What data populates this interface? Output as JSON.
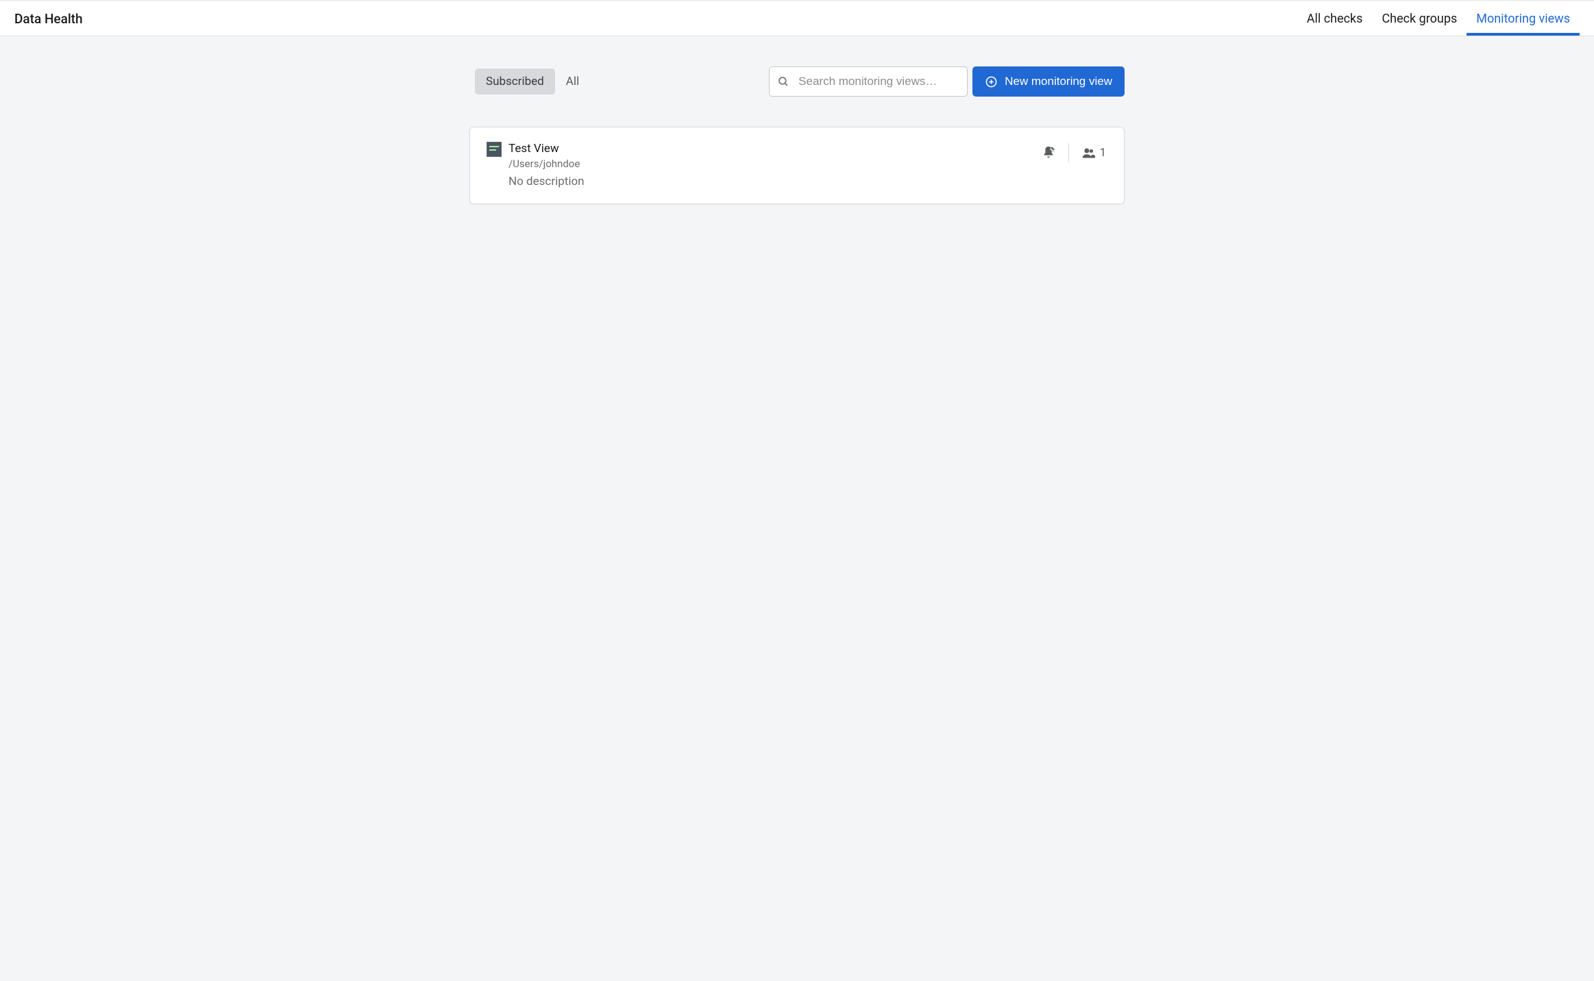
{
  "header": {
    "title": "Data Health",
    "tabs": [
      {
        "label": "All checks",
        "active": false
      },
      {
        "label": "Check groups",
        "active": false
      },
      {
        "label": "Monitoring views",
        "active": true
      }
    ]
  },
  "controls": {
    "filters": {
      "subscribed": "Subscribed",
      "all": "All"
    },
    "search_placeholder": "Search monitoring views…",
    "new_button": "New monitoring view"
  },
  "views": [
    {
      "title": "Test View",
      "path": "/Users/johndoe",
      "description": "No description",
      "subscriber_count": "1"
    }
  ]
}
